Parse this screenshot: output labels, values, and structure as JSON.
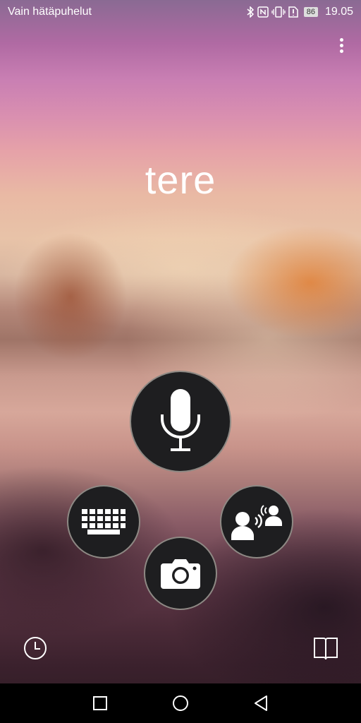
{
  "statusbar": {
    "carrier_text": "Vain hätäpuhelut",
    "battery_level": "86",
    "time": "19.05",
    "icons": [
      "bluetooth-icon",
      "nfc-icon",
      "vibrate-icon",
      "sim-alert-icon",
      "battery-icon"
    ]
  },
  "main": {
    "phrase": "tere"
  },
  "buttons": {
    "voice": "microphone-icon",
    "keyboard": "keyboard-icon",
    "conversation": "conversation-icon",
    "camera": "camera-icon"
  },
  "footer": {
    "left_icon": "history-icon",
    "right_icon": "phrasebook-icon"
  },
  "navigation": [
    "recent-apps-icon",
    "home-icon",
    "back-icon"
  ],
  "colors": {
    "button_fill": "#1e1e20",
    "button_ring": "#ebe1d7",
    "nav_bar": "#000000"
  }
}
